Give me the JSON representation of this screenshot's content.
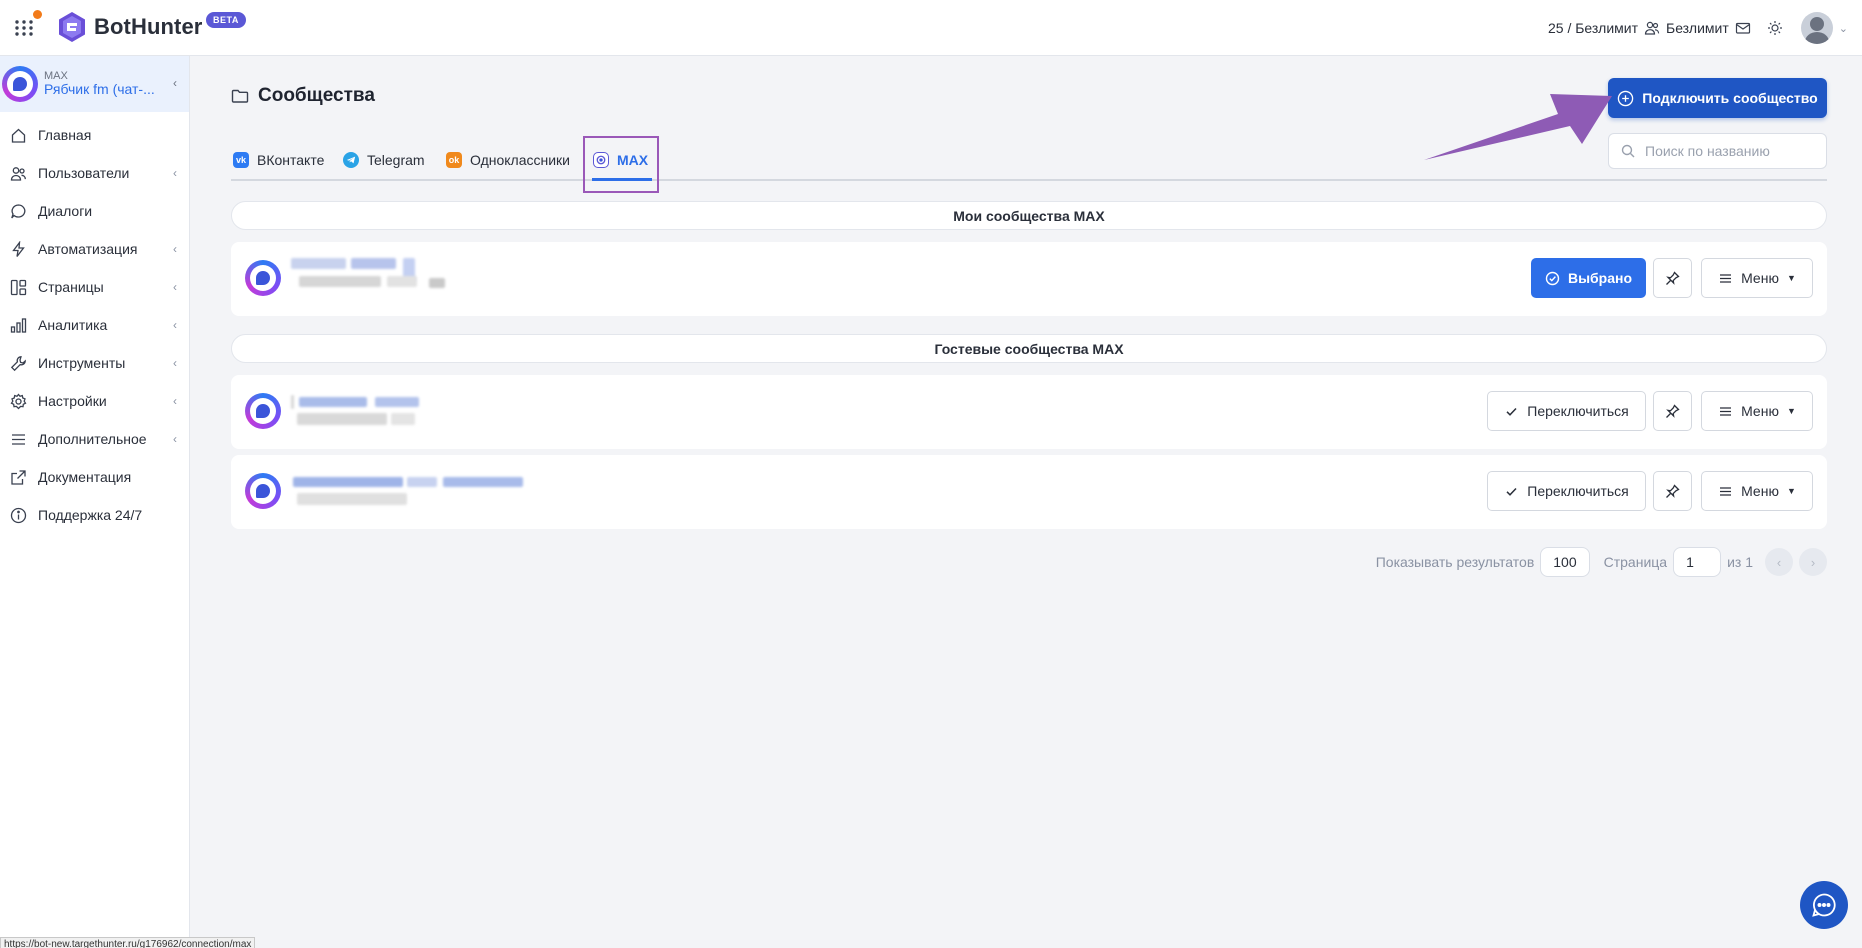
{
  "app": {
    "brand": "BotHunter",
    "badge": "BETA",
    "status_url": "https://bot-new.targethunter.ru/g176962/connection/max"
  },
  "topbar": {
    "limits": "25 / Безлимит",
    "users_limit": "Безлимит"
  },
  "sidebar": {
    "project_label": "MAX",
    "project_name": "Рябчик fm (чат-...",
    "items": [
      {
        "label": "Главная",
        "icon": "home-icon",
        "expandable": false
      },
      {
        "label": "Пользователи",
        "icon": "users-icon",
        "expandable": true
      },
      {
        "label": "Диалоги",
        "icon": "chat-icon",
        "expandable": false
      },
      {
        "label": "Автоматизация",
        "icon": "bolt-icon",
        "expandable": true
      },
      {
        "label": "Страницы",
        "icon": "pages-icon",
        "expandable": true
      },
      {
        "label": "Аналитика",
        "icon": "chart-icon",
        "expandable": true
      },
      {
        "label": "Инструменты",
        "icon": "wrench-icon",
        "expandable": true
      },
      {
        "label": "Настройки",
        "icon": "gear-icon",
        "expandable": true
      },
      {
        "label": "Дополнительное",
        "icon": "menu-icon",
        "expandable": true
      },
      {
        "label": "Документация",
        "icon": "external-link-icon",
        "expandable": false
      },
      {
        "label": "Поддержка 24/7",
        "icon": "info-icon",
        "expandable": false
      }
    ]
  },
  "main": {
    "title": "Сообщества",
    "connect_button": "Подключить сообщество",
    "search_placeholder": "Поиск по названию",
    "tabs": [
      {
        "label": "ВКонтакте",
        "icon": "vk-icon",
        "color": "#2d7bf3"
      },
      {
        "label": "Telegram",
        "icon": "telegram-icon",
        "color": "#2aa3e6"
      },
      {
        "label": "Одноклассники",
        "icon": "ok-icon",
        "color": "#f0891c"
      },
      {
        "label": "MAX",
        "icon": "max-icon",
        "color": "#5b58d6",
        "active": true
      }
    ],
    "my_section": "Мои сообщества MAX",
    "guest_section": "Гостевые сообщества MAX",
    "selected_label": "Выбрано",
    "switch_label": "Переключиться",
    "menu_label": "Меню",
    "pagination": {
      "show_label": "Показывать результатов",
      "per_page": "100",
      "page_label": "Страница",
      "page": "1",
      "of_label": "из 1"
    }
  },
  "colors": {
    "accent": "#2d6ee8",
    "primary_button": "#1f56c4",
    "annotation_arrow": "#8e5bb5"
  }
}
